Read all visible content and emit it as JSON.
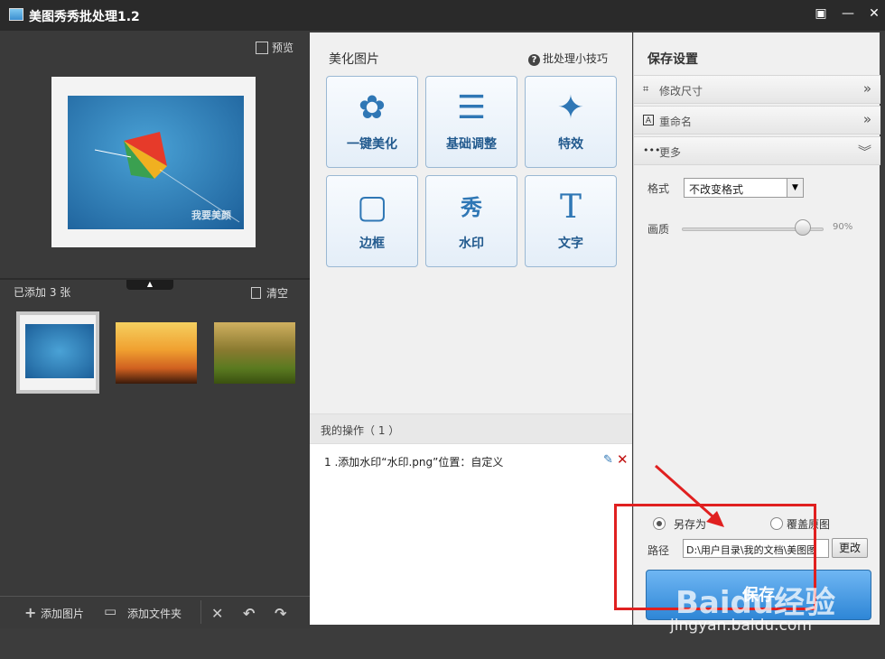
{
  "window": {
    "title": "美图秀秀批处理1.2",
    "controls": {
      "chat": "▣",
      "minimize": "—",
      "maximize": "▢",
      "close": "✕"
    }
  },
  "left": {
    "preview_label": "预览",
    "preview_watermark": "我要美颜",
    "added_label": "已添加 3 张",
    "clear_label": "清空",
    "toolbar": {
      "add_image": "添加图片",
      "add_folder": "添加文件夹"
    }
  },
  "middle": {
    "title": "美化图片",
    "tips": "批处理小技巧",
    "tools": [
      {
        "label": "一键美化",
        "glyph": "✿"
      },
      {
        "label": "基础调整",
        "glyph": "☰"
      },
      {
        "label": "特效",
        "glyph": "✦"
      },
      {
        "label": "边框",
        "glyph": "▢"
      },
      {
        "label": "水印",
        "glyph": "秀"
      },
      {
        "label": "文字",
        "glyph": "T"
      }
    ],
    "ops_title": "我的操作（ 1 ）",
    "ops": [
      "1 .添加水印“水印.png”位置：自定义"
    ]
  },
  "right": {
    "title": "保存设置",
    "sections": [
      {
        "label": "修改尺寸",
        "arrow": "»"
      },
      {
        "label": "重命名",
        "arrow": "»"
      },
      {
        "label": "更多",
        "arrow": "︾"
      }
    ],
    "format_label": "格式",
    "format_value": "不改变格式",
    "quality_label": "画质",
    "quality_value": "90%",
    "quality_level": 0.9,
    "save_as_label": "另存为",
    "overwrite_label": "覆盖原图",
    "path_label": "路径",
    "path_value": "D:\\用户目录\\我的文档\\美图图",
    "change_label": "更改",
    "save_label": "保存"
  },
  "watermark_site": {
    "brand": "Baidu经验",
    "url": "jingyan.baidu.com"
  },
  "colors": {
    "accent": "#2f77b5",
    "highlight": "#e02020"
  }
}
